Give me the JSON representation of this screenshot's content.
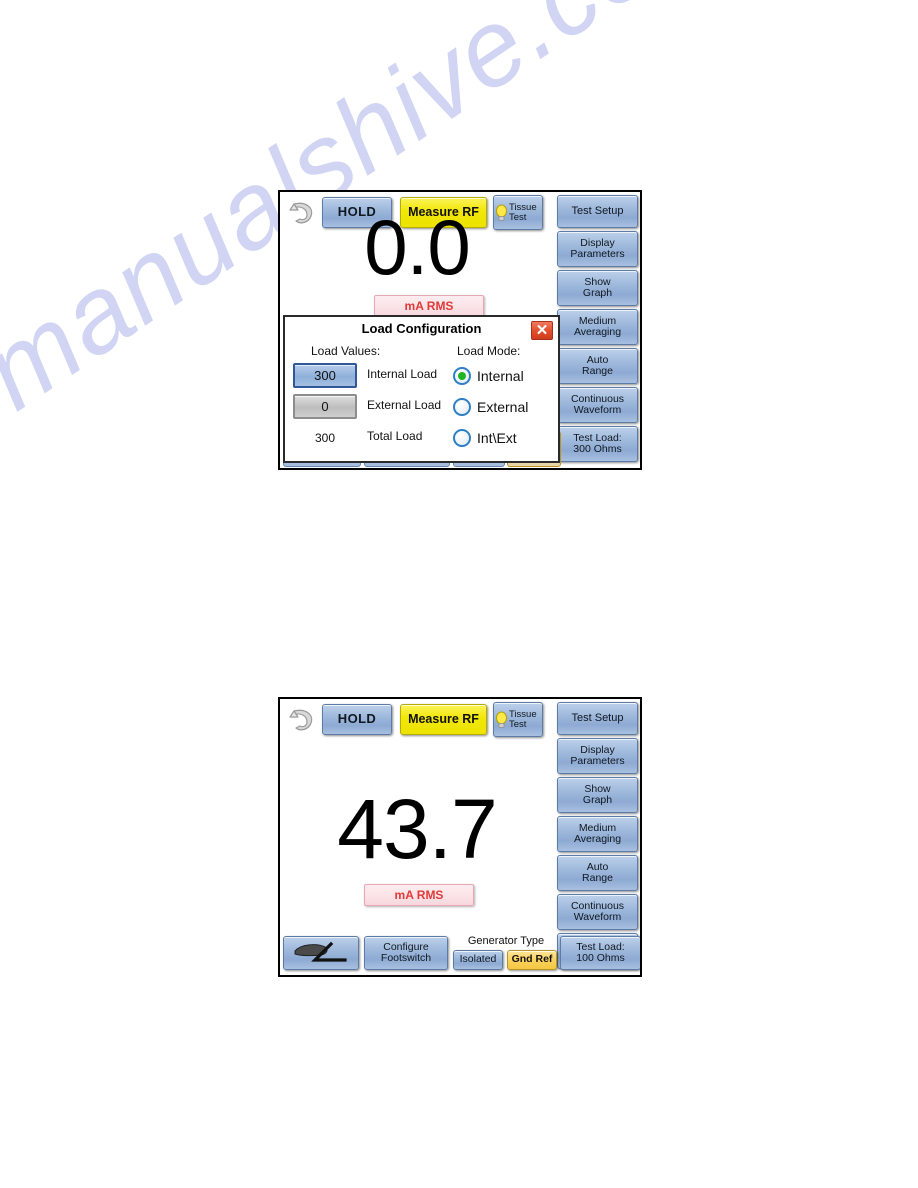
{
  "watermark": {
    "text": "manualshive.com"
  },
  "panel_top": {
    "name": "Load Configuration screen",
    "back_icon": "back-arrow-icon",
    "toolbar": {
      "hold_label": "HOLD",
      "measure_label": "Measure RF",
      "tissue_line1": "Tissue",
      "tissue_line2": "Test",
      "tissue_icon": "lightbulb-icon"
    },
    "readout": {
      "value": "0.0",
      "unit": "mA RMS"
    },
    "side_buttons": [
      {
        "line1": "Test  Setup",
        "line2": ""
      },
      {
        "line1": "Display",
        "line2": "Parameters"
      },
      {
        "line1": "Show",
        "line2": "Graph"
      },
      {
        "line1": "Medium",
        "line2": "Averaging"
      },
      {
        "line1": "Auto",
        "line2": "Range"
      },
      {
        "line1": "Continuous",
        "line2": "Waveform"
      },
      {
        "line1": "Test  Load:",
        "line2": "300  Ohms"
      }
    ],
    "dialog": {
      "title": "Load Configuration",
      "close_icon": "close-icon",
      "header_left": "Load Values:",
      "header_right": "Load Mode:",
      "rows": [
        {
          "value": "300",
          "label": "Internal Load",
          "mode": "Internal",
          "selected": true
        },
        {
          "value": "0",
          "label": "External Load",
          "mode": "External",
          "selected": false
        },
        {
          "value": "300",
          "label": "Total Load",
          "mode": "Int\\Ext",
          "selected": false
        }
      ]
    }
  },
  "panel_bottom": {
    "name": "Measure RF reading screen",
    "back_icon": "back-arrow-icon",
    "toolbar": {
      "hold_label": "HOLD",
      "measure_label": "Measure RF",
      "tissue_line1": "Tissue",
      "tissue_line2": "Test",
      "tissue_icon": "lightbulb-icon"
    },
    "readout": {
      "value": "43.7",
      "unit": "mA RMS"
    },
    "side_buttons": [
      {
        "line1": "Test  Setup",
        "line2": ""
      },
      {
        "line1": "Display",
        "line2": "Parameters"
      },
      {
        "line1": "Show",
        "line2": "Graph"
      },
      {
        "line1": "Medium",
        "line2": "Averaging"
      },
      {
        "line1": "Auto",
        "line2": "Range"
      },
      {
        "line1": "Continuous",
        "line2": "Waveform"
      },
      {
        "line1": "Test  Load:",
        "line2": "100  Ohms"
      }
    ],
    "bottom_bar": {
      "footswitch_icon": "footswitch-pedal-icon",
      "configure_line1": "Configure",
      "configure_line2": "Footswitch",
      "generator_type_label": "Generator Type",
      "generator_isolated": "Isolated",
      "generator_gnd_ref": "Gnd Ref",
      "generator_selected": "Gnd Ref"
    }
  },
  "colors": {
    "button_blue": "#9fb9dc",
    "button_yellow": "#f2e708",
    "button_gold": "#fbd25c",
    "unit_red": "#e03a3a",
    "unit_pink_bg": "#fbe3e7",
    "radio_green": "#21b521",
    "close_red": "#e2502f",
    "watermark_blue": "#c9cdf2"
  }
}
